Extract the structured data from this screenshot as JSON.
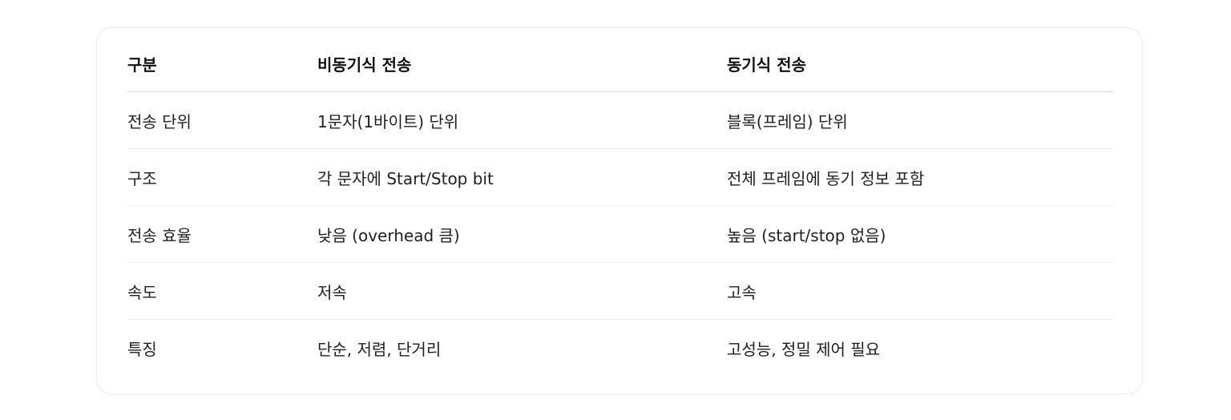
{
  "table": {
    "headers": [
      "구분",
      "비동기식 전송",
      "동기식 전송"
    ],
    "rows": [
      [
        "전송 단위",
        "1문자(1바이트) 단위",
        "블록(프레임) 단위"
      ],
      [
        "구조",
        "각 문자에 Start/Stop bit",
        "전체 프레임에 동기 정보 포함"
      ],
      [
        "전송 효율",
        "낮음 (overhead 큼)",
        "높음 (start/stop 없음)"
      ],
      [
        "속도",
        "저속",
        "고속"
      ],
      [
        "특징",
        "단순, 저렴, 단거리",
        "고성능, 정밀 제어 필요"
      ]
    ]
  }
}
